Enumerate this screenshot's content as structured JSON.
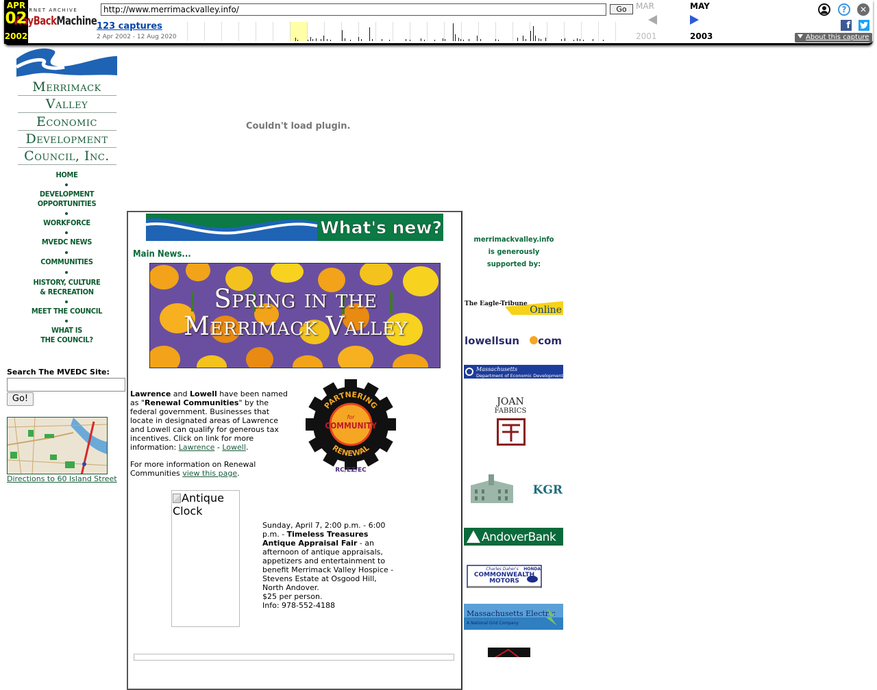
{
  "wayback": {
    "logo_top": "INTERNET ARCHIVE",
    "logo_wayback": "WayBack",
    "logo_machine": "Machine",
    "url": "http://www.merrimackvalley.info/",
    "go_label": "Go",
    "captures_label": "123 captures",
    "date_range": "2 Apr 2002 - 12 Aug 2020",
    "prev_month": "MAR",
    "current_month": "APR",
    "current_day": "02",
    "current_year": "2002",
    "next_month": "MAY",
    "prev_year": "2001",
    "next_year": "2003",
    "help_glyph": "?",
    "close_glyph": "✕",
    "facebook_glyph": "f",
    "twitter_glyph": "🐦",
    "about_label": "About this capture",
    "colors": {
      "highlight": "#ffffa8",
      "calendar_bg": "#000000",
      "calendar_fg": "#ffff00"
    }
  },
  "sidebar": {
    "logo_lines": [
      "Merrimack",
      "Valley",
      "Economic",
      "Development",
      "Council, Inc."
    ],
    "nav": [
      {
        "lines": [
          "HOME"
        ]
      },
      {
        "lines": [
          "DEVELOPMENT",
          "OPPORTUNITIES"
        ]
      },
      {
        "lines": [
          "WORKFORCE"
        ]
      },
      {
        "lines": [
          "MVEDC NEWS"
        ]
      },
      {
        "lines": [
          "COMMUNITIES"
        ]
      },
      {
        "lines": [
          "HISTORY, CULTURE",
          "& RECREATION"
        ]
      },
      {
        "lines": [
          "MEET THE COUNCIL"
        ]
      },
      {
        "lines": [
          "WHAT IS",
          "THE COUNCIL?"
        ]
      }
    ],
    "search_label": "Search The MVEDC Site:",
    "search_value": "",
    "search_button": "Go!",
    "directions_link": "Directions to 60 Island Street"
  },
  "plugin_message": "Couldn't load plugin.",
  "main": {
    "whats_new": "What's new?",
    "main_news": "Main News...",
    "spring_line1": "Spring in the",
    "spring_line2": "Merrimack Valley",
    "renewal": {
      "t1": "Lawrence",
      "t2": " and ",
      "t3": "Lowell",
      "t4": " have been named as \"",
      "t5": "Renewal Communities",
      "t6": "\" by the federal government. Businesses that locate in designated areas of Lawrence and Lowell can qualify for generous tax incentives. Click on link for more information: ",
      "link1": "Lawrence",
      "sep": " - ",
      "link2": "Lowell",
      "end": ".",
      "more_pre": "For more information on Renewal Communities ",
      "more_link": "view this page",
      "more_end": "."
    },
    "rc_logo": {
      "top": "PARTNERING",
      "for": "for",
      "community": "COMMUNITY",
      "bottom": "RENEWAL",
      "sub": "RC/EZ/EC"
    },
    "clock_alt": "Antique Clock",
    "event": {
      "when": "Sunday, April 7, 2:00 p.m. - 6:00 p.m. - ",
      "title": "Timeless Treasures Antique Appraisal Fair",
      "desc": " - an afternoon of antique appraisals, appetizers and entertainment to benefit Merrimack Valley Hospice - Stevens Estate at Osgood Hill, North Andover.",
      "price": "$25 per person.",
      "info": "Info: 978-552-4188"
    }
  },
  "sponsors": {
    "header_lines": [
      "merrimackvalley.info",
      "is generously",
      "supported by:"
    ],
    "items": [
      {
        "name": "eagle-tribune",
        "label": "The Eagle-Tribune",
        "label2": "Online"
      },
      {
        "name": "lowellsun",
        "label": "lowellsun",
        "label2": "com"
      },
      {
        "name": "mass-econ-dev",
        "label": "Massachusetts",
        "label2": "Department of Economic Development"
      },
      {
        "name": "joan-fabrics",
        "label": "JOAN",
        "label2": "FABRICS"
      },
      {
        "name": "kgr",
        "label": "KGR"
      },
      {
        "name": "andover-bank",
        "label": "AndoverBank"
      },
      {
        "name": "commonwealth-motors",
        "label": "Charles Daher's",
        "label2": "COMMONWEALTH",
        "label3": "MOTORS",
        "label4": "HONDA"
      },
      {
        "name": "mass-electric",
        "label": "Massachusetts Electric",
        "label2": "A National Grid Company"
      }
    ]
  }
}
